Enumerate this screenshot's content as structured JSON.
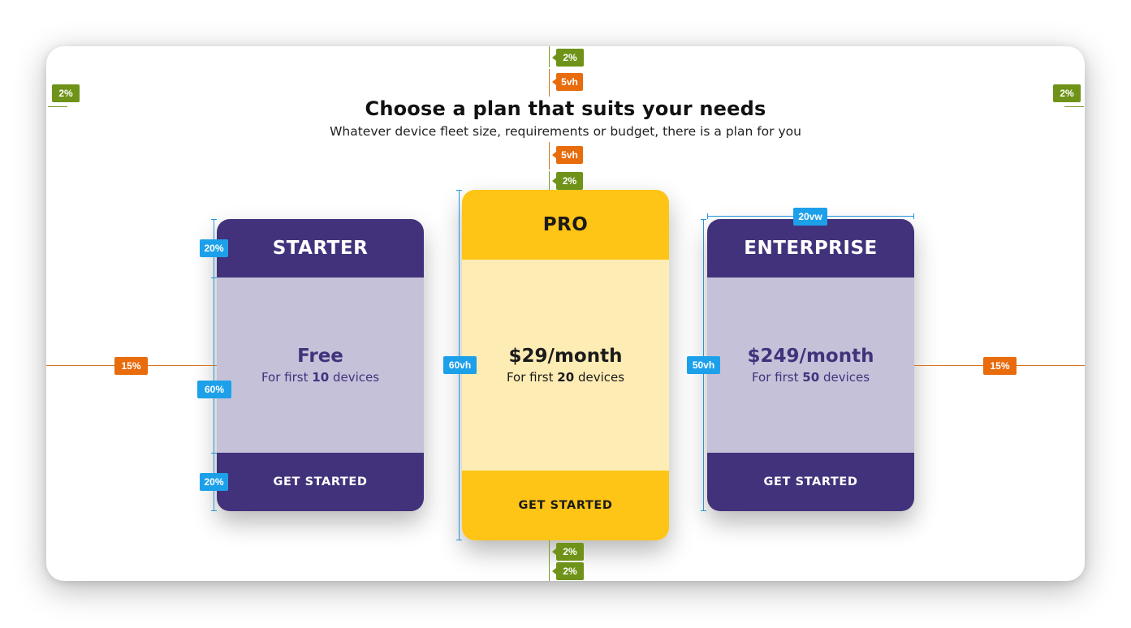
{
  "header": {
    "title": "Choose a plan that suits your needs",
    "subtitle": "Whatever device fleet size, requirements or budget, there is a plan for you"
  },
  "plans": [
    {
      "name": "STARTER",
      "price": "Free",
      "devices_prefix": "For first",
      "devices_count": "10",
      "devices_suffix": "devices",
      "cta": "GET STARTED"
    },
    {
      "name": "PRO",
      "price": "$29/month",
      "devices_prefix": "For first",
      "devices_count": "20",
      "devices_suffix": "devices",
      "cta": "GET STARTED"
    },
    {
      "name": "ENTERPRISE",
      "price": "$249/month",
      "devices_prefix": "For first",
      "devices_count": "50",
      "devices_suffix": "devices",
      "cta": "GET STARTED"
    }
  ],
  "annotations": {
    "frame_padding_left": "2%",
    "frame_padding_right": "2%",
    "top_gap_1": "2%",
    "top_gap_2": "5vh",
    "header_gap_1": "5vh",
    "header_gap_2": "2%",
    "bottom_gap_1": "2%",
    "bottom_gap_2": "2%",
    "side_margin_left": "15%",
    "side_margin_right": "15%",
    "starter_head_height": "20%",
    "starter_body_height": "60%",
    "starter_foot_height": "20%",
    "pro_height": "60vh",
    "enterprise_height": "50vh",
    "enterprise_width": "20vw"
  },
  "colors": {
    "purple": "#42327b",
    "purple_light": "#c5c1d9",
    "gold": "#fec416",
    "gold_light": "#fdecb4",
    "badge_olive": "#6e9318",
    "badge_orange": "#e86b0c",
    "badge_blue": "#1da0ea"
  }
}
